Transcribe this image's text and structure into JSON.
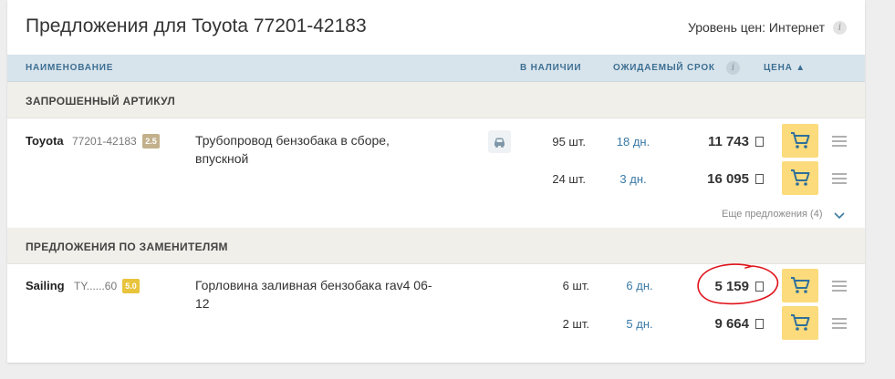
{
  "header": {
    "title": "Предложения для Toyota 77201-42183",
    "price_level_label": "Уровень цен: Интернет",
    "info_glyph": "i"
  },
  "columns": {
    "name": "Наименование",
    "stock": "В наличии",
    "term": "Ожидаемый срок",
    "price": "Цена ▲"
  },
  "sections": {
    "requested": "ЗАПРОШЕННЫЙ АРТИКУЛ",
    "substitutes": "ПРЕДЛОЖЕНИЯ ПО ЗАМЕНИТЕЛЯМ"
  },
  "requested_item": {
    "brand": "Toyota",
    "article": "77201-42183",
    "rating": "2.5",
    "description": "Трубопровод бензобака в сборе, впускной",
    "offers": [
      {
        "stock": "95 шт.",
        "term": "18 дн.",
        "price": "11 743"
      },
      {
        "stock": "24 шт.",
        "term": "3 дн.",
        "price": "16 095"
      }
    ],
    "more_offers": "Еще предложения (4)"
  },
  "substitute_item": {
    "brand": "Sailing",
    "article": "TY......60",
    "rating": "5.0",
    "description": "Горловина заливная бензобака rav4 06-12",
    "offers": [
      {
        "stock": "6 шт.",
        "term": "6 дн.",
        "price": "5 159"
      },
      {
        "stock": "2 шт.",
        "term": "5 дн.",
        "price": "9 664"
      }
    ]
  },
  "icons": {
    "cart": "cart-icon",
    "menu": "menu-icon",
    "car": "car-icon",
    "info": "info-icon",
    "chevron": "chevron-down-icon"
  },
  "colors": {
    "header_bg": "#d8e4ec",
    "header_text": "#3d6f92",
    "section_bg": "#f1efe9",
    "cart_button": "#fbdb7b",
    "term_link": "#3a7aa6",
    "annotation_circle": "#e0141c"
  }
}
